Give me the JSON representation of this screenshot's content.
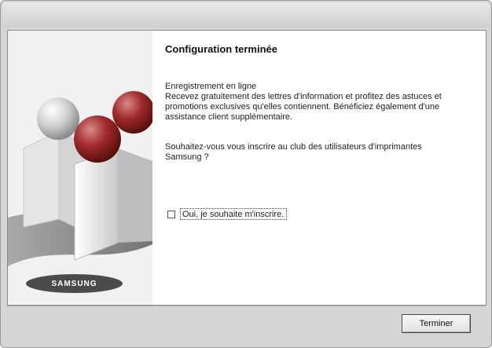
{
  "brand": {
    "logo_text": "SAMSUNG"
  },
  "main": {
    "heading": "Configuration terminée",
    "paragraph1": [
      "Enregistrement en ligne",
      "Recevez gratuitement des lettres d'information et profitez des astuces et",
      "promotions exclusives qu'elles contiennent. Bénéficiez également d'une",
      "assistance client supplémentaire."
    ],
    "paragraph2": [
      "Souhaitez-vous vous inscrire au club des utilisateurs d'imprimantes",
      "Samsung ?"
    ],
    "checkbox": {
      "label": "Oui, je souhaite m'inscrire.",
      "checked": false
    }
  },
  "footer": {
    "finish_button": "Terminer"
  },
  "colors": {
    "window_bg": "#d6d6d6",
    "content_bg": "#ffffff",
    "accent_red": "#a12a2a",
    "accent_gray": "#b8b8b8"
  },
  "icons": [
    "spheres-illustration",
    "samsung-logo"
  ]
}
